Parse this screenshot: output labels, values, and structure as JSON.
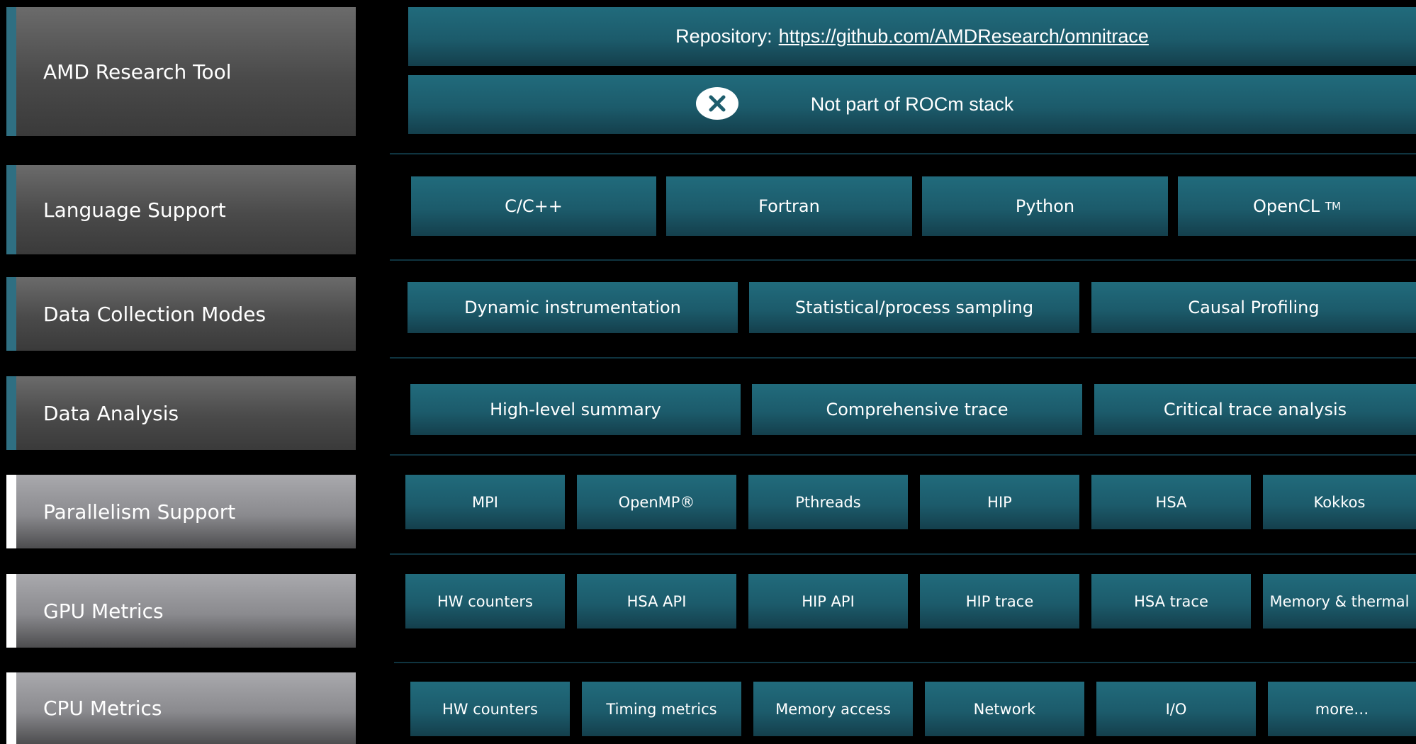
{
  "rows": [
    {
      "label": "AMD Research Tool"
    },
    {
      "label": "Language Support"
    },
    {
      "label": "Data Collection Modes"
    },
    {
      "label": "Data Analysis"
    },
    {
      "label": "Parallelism Support"
    },
    {
      "label": "GPU Metrics"
    },
    {
      "label": "CPU Metrics"
    }
  ],
  "research_tool": {
    "repo_prefix": "Repository:",
    "repo_url": "https://github.com/AMDResearch/omnitrace",
    "rocm_status": "Not part of ROCm stack",
    "rocm_icon": "x-icon"
  },
  "language_support": [
    "C/C++",
    "Fortran",
    "Python",
    "OpenCL"
  ],
  "opencl_tm": "TM",
  "data_collection_modes": [
    "Dynamic instrumentation",
    "Statistical/process sampling",
    "Causal Profiling"
  ],
  "data_analysis": [
    "High-level summary",
    "Comprehensive trace",
    "Critical trace analysis"
  ],
  "parallelism_support": [
    "MPI",
    "OpenMP®",
    "Pthreads",
    "HIP",
    "HSA",
    "Kokkos"
  ],
  "gpu_metrics": [
    "HW counters",
    "HSA API",
    "HIP API",
    "HIP trace",
    "HSA trace",
    "Memory & thermal"
  ],
  "cpu_metrics": [
    "HW counters",
    "Timing metrics",
    "Memory access",
    "Network",
    "I/O",
    "more…"
  ],
  "colors": {
    "box": "#1c5b6b",
    "accent_dark": "#2f6f82",
    "accent_light": "#ffffff"
  }
}
